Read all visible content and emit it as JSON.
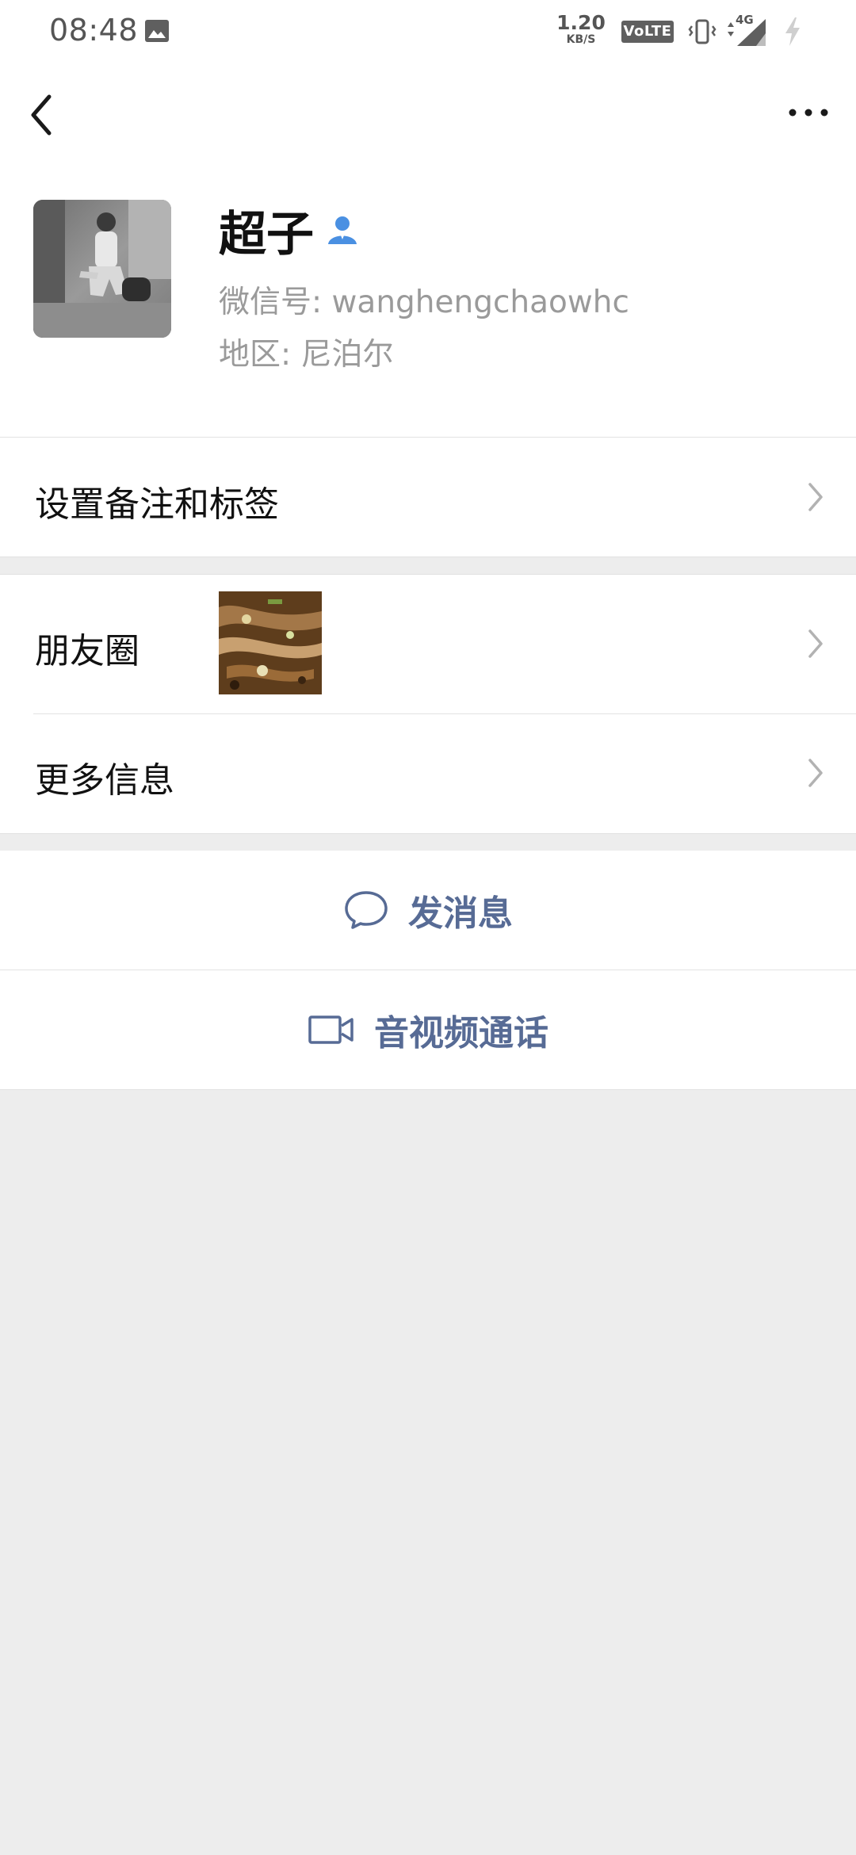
{
  "status_bar": {
    "time": "08:48",
    "net_speed_value": "1.20",
    "net_speed_unit": "KB/S",
    "volte": "VoLTE",
    "network": "4G",
    "icons": [
      "image-icon",
      "vibrate-icon",
      "signal-icon",
      "charging-icon"
    ]
  },
  "nav": {
    "back_icon": "chevron-left-icon",
    "more_icon": "ellipsis-icon"
  },
  "profile": {
    "name": "超子",
    "wechat_id": "微信号: wanghengchaowhc",
    "region": "地区: 尼泊尔",
    "verify_icon": "contact-person-icon"
  },
  "rows": {
    "remark_label": "设置备注和标签",
    "moments_label": "朋友圈",
    "more_info_label": "更多信息"
  },
  "actions": {
    "message_label": "发消息",
    "call_label": "音视频通话"
  },
  "colors": {
    "background": "#ededed",
    "link_blue": "#576b95",
    "secondary_text": "#9a9a9a",
    "verify_blue": "#4a90e2"
  }
}
